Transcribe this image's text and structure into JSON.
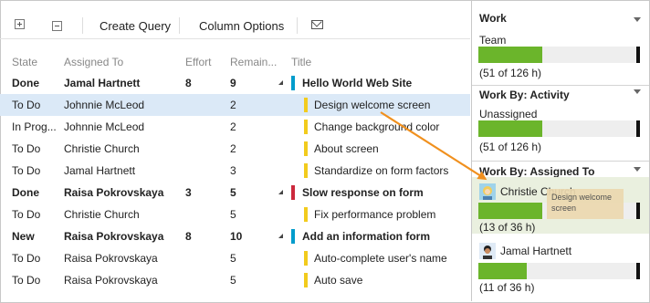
{
  "toolbar": {
    "create_query": "Create Query",
    "column_options": "Column Options"
  },
  "columns": {
    "state": "State",
    "assigned_to": "Assigned To",
    "effort": "Effort",
    "remaining": "Remain...",
    "title": "Title"
  },
  "rows": [
    {
      "state": "Done",
      "assigned": "Jamal Hartnett",
      "effort": "8",
      "remaining": "9",
      "title": "Hello World Web Site",
      "parent": true,
      "color": "#009ccc"
    },
    {
      "state": "To Do",
      "assigned": "Johnnie McLeod",
      "effort": "",
      "remaining": "2",
      "title": "Design welcome screen",
      "parent": false,
      "color": "#f2cb1d"
    },
    {
      "state": "In Prog...",
      "assigned": "Johnnie McLeod",
      "effort": "",
      "remaining": "2",
      "title": "Change background color",
      "parent": false,
      "color": "#f2cb1d"
    },
    {
      "state": "To Do",
      "assigned": "Christie Church",
      "effort": "",
      "remaining": "2",
      "title": "About screen",
      "parent": false,
      "color": "#f2cb1d"
    },
    {
      "state": "To Do",
      "assigned": "Jamal Hartnett",
      "effort": "",
      "remaining": "3",
      "title": "Standardize on form factors",
      "parent": false,
      "color": "#f2cb1d"
    },
    {
      "state": "Done",
      "assigned": "Raisa Pokrovskaya",
      "effort": "3",
      "remaining": "5",
      "title": "Slow response on form",
      "parent": true,
      "color": "#cc293d"
    },
    {
      "state": "To Do",
      "assigned": "Christie Church",
      "effort": "",
      "remaining": "5",
      "title": "Fix performance problem",
      "parent": false,
      "color": "#f2cb1d"
    },
    {
      "state": "New",
      "assigned": "Raisa Pokrovskaya",
      "effort": "8",
      "remaining": "10",
      "title": "Add an information form",
      "parent": true,
      "color": "#009ccc"
    },
    {
      "state": "To Do",
      "assigned": "Raisa Pokrovskaya",
      "effort": "",
      "remaining": "5",
      "title": "Auto-complete user's name",
      "parent": false,
      "color": "#f2cb1d"
    },
    {
      "state": "To Do",
      "assigned": "Raisa Pokrovskaya",
      "effort": "",
      "remaining": "5",
      "title": "Auto save",
      "parent": false,
      "color": "#f2cb1d"
    }
  ],
  "work": {
    "title": "Work",
    "label": "Team",
    "summary": "(51 of 126 h)",
    "progress": 0.4
  },
  "activity": {
    "title": "Work By: Activity",
    "label": "Unassigned",
    "summary": "(51 of 126 h)",
    "progress": 0.4
  },
  "assigned": {
    "title": "Work By: Assigned To",
    "people": [
      {
        "name": "Christie Church",
        "summary": "(13 of 36 h)",
        "progress": 0.4
      },
      {
        "name": "Jamal Hartnett",
        "summary": "(11 of 36 h)",
        "progress": 0.3
      }
    ]
  },
  "tooltip": "Design welcome screen",
  "colors": {
    "accent": "#6bb52b",
    "arrow": "#f0901e",
    "selected_row": "#dbe9f7"
  }
}
